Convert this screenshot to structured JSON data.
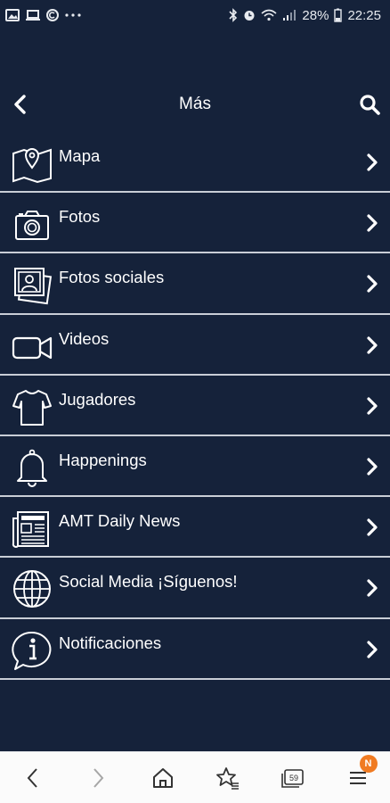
{
  "status_bar": {
    "battery": "28%",
    "time": "22:25"
  },
  "header": {
    "title": "Más"
  },
  "menu": [
    {
      "label": "Mapa",
      "icon": "map-icon"
    },
    {
      "label": "Fotos",
      "icon": "camera-icon"
    },
    {
      "label": "Fotos sociales",
      "icon": "photos-stack-icon"
    },
    {
      "label": "Videos",
      "icon": "video-camera-icon"
    },
    {
      "label": "Jugadores",
      "icon": "shirt-icon"
    },
    {
      "label": "Happenings",
      "icon": "bell-icon"
    },
    {
      "label": "AMT Daily News",
      "icon": "newspaper-icon"
    },
    {
      "label": "Social Media ¡Síguenos!",
      "icon": "globe-icon"
    },
    {
      "label": "Notificaciones",
      "icon": "info-bubble-icon"
    }
  ],
  "browser_bar": {
    "tab_count": "59",
    "badge": "N"
  },
  "colors": {
    "background": "#15223a",
    "divider": "#c9ced6",
    "badge": "#f07b22"
  }
}
